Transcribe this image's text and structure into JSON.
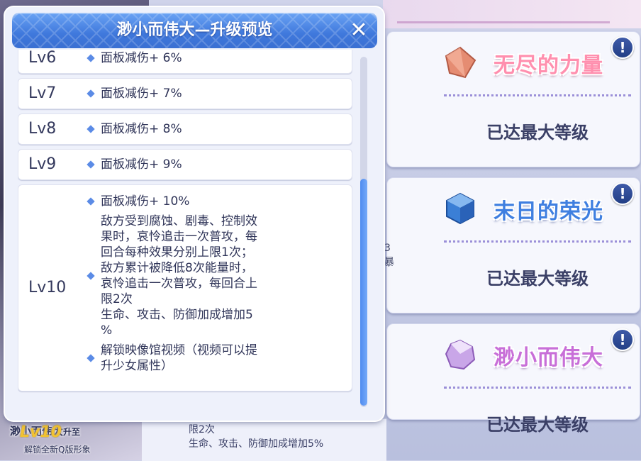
{
  "background": {
    "cards": [
      {
        "title": "无尽的力量",
        "status": "已达最大等级",
        "gem_color": "#e58c72",
        "title_style": "pink"
      },
      {
        "title": "末日的荣光",
        "status": "已达最大等级",
        "gem_color": "#3b7fd6",
        "title_style": "blue"
      },
      {
        "title": "渺小而伟大",
        "status": "已达最大等级",
        "gem_color": "#c9a6e8",
        "title_style": "purple"
      }
    ],
    "info_glyph": "!",
    "partial_texts": [
      "3",
      "暴"
    ],
    "bottom_strip": {
      "line1": "限2次",
      "line2": "生命、攻击、防御加成增加5%"
    },
    "caption": {
      "name": "渺小而伟大",
      "upgrade": "升至",
      "level": "Lv10",
      "sub": "解锁全新Q版形象"
    }
  },
  "modal": {
    "title": "渺小而伟大—升级预览",
    "close_glyph": "✕",
    "rows": [
      {
        "level": "Lv6",
        "effects": [
          "面板减伤+ 6%"
        ]
      },
      {
        "level": "Lv7",
        "effects": [
          "面板减伤+ 7%"
        ]
      },
      {
        "level": "Lv8",
        "effects": [
          "面板减伤+ 8%"
        ]
      },
      {
        "level": "Lv9",
        "effects": [
          "面板减伤+ 9%"
        ]
      },
      {
        "level": "Lv10",
        "effects": [
          "面板减伤+ 10%",
          "敌方受到腐蚀、剧毒、控制效\n果时，哀怜追击一次普攻，每\n回合每种效果分别上限1次；\n敌方累计被降低8次能量时，\n哀怜追击一次普攻，每回合上\n限2次\n生命、攻击、防御加成增加5\n%",
          "解锁映像馆视频（视频可以提\n升少女属性）"
        ]
      }
    ]
  },
  "colors": {
    "accent": "#3f78dc",
    "diamond": "#5b8be6",
    "text_dark": "#2f3458",
    "scroll_thumb": "#4f8cf0"
  }
}
